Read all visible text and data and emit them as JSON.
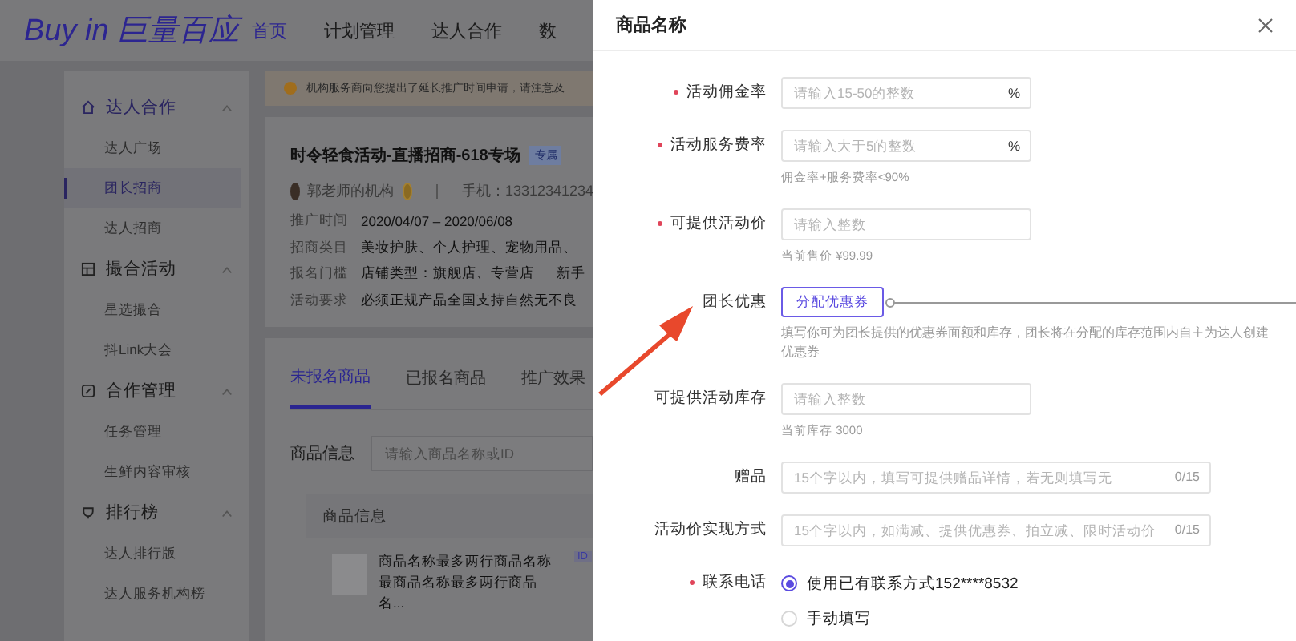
{
  "header": {
    "logo": "Buy in 巨量百应",
    "nav": [
      {
        "label": "首页",
        "selected": true
      },
      {
        "label": "计划管理",
        "selected": false
      },
      {
        "label": "达人合作",
        "selected": false
      },
      {
        "label": "数",
        "selected": false
      }
    ]
  },
  "sidebar": {
    "groups": [
      {
        "label": "达人合作",
        "expanded": true,
        "items": [
          {
            "label": "达人广场",
            "selected": false
          },
          {
            "label": "团长招商",
            "selected": true
          },
          {
            "label": "达人招商",
            "selected": false
          }
        ]
      },
      {
        "label": "撮合活动",
        "expanded": true,
        "items": [
          {
            "label": "星选撮合",
            "selected": false
          },
          {
            "label": "抖Link大会",
            "selected": false
          }
        ]
      },
      {
        "label": "合作管理",
        "expanded": true,
        "items": [
          {
            "label": "任务管理",
            "selected": false
          },
          {
            "label": "生鲜内容审核",
            "selected": false
          }
        ]
      },
      {
        "label": "排行榜",
        "expanded": true,
        "items": [
          {
            "label": "达人排行版",
            "selected": false
          },
          {
            "label": "达人服务机构榜",
            "selected": false
          }
        ]
      }
    ]
  },
  "notice": "机构服务商向您提出了延长推广时间申请，请注意及",
  "activity": {
    "title": "时令轻食活动-直播招商-618专场",
    "tag": "专属",
    "organizer": "郭老师的机构",
    "phone": "手机：13312341234",
    "details": [
      {
        "label": "推广时间",
        "value": "2020/04/07 – 2020/06/08"
      },
      {
        "label": "招商类目",
        "value": "美妆护肤、个人护理、宠物用品、"
      },
      {
        "label": "报名门槛",
        "value": "店铺类型：旗舰店、专营店",
        "extra": "新手"
      },
      {
        "label": "活动要求",
        "value": "必须正规产品全国支持自然无不良"
      }
    ]
  },
  "tabs": [
    {
      "label": "未报名商品",
      "selected": true
    },
    {
      "label": "已报名商品",
      "selected": false
    },
    {
      "label": "推广效果",
      "selected": false
    }
  ],
  "search": {
    "label": "商品信息",
    "placeholder": "请输入商品名称或ID"
  },
  "table": {
    "columns": [
      "商品信息"
    ],
    "rows": [
      {
        "name": "商品名称最多两行商品名称最商品名称最多两行商品名...",
        "badge": "ID"
      }
    ]
  },
  "drawer": {
    "title": "商品名称",
    "fields": [
      {
        "kind": "input",
        "label": "活动佣金率",
        "required": true,
        "placeholder": "请输入15-50的整数",
        "suffix": "%"
      },
      {
        "kind": "input",
        "label": "活动服务费率",
        "required": true,
        "placeholder": "请输入大于5的整数",
        "suffix": "%",
        "help": "佣金率+服务费率<90%"
      },
      {
        "kind": "input",
        "label": "可提供活动价",
        "required": true,
        "placeholder": "请输入整数",
        "help": "当前售价 ¥99.99"
      },
      {
        "kind": "button",
        "label": "团长优惠",
        "required": false,
        "button": "分配优惠券",
        "help": "填写你可为团长提供的优惠券面额和库存，团长将在分配的库存范围内自主为达人创建优惠券"
      },
      {
        "kind": "input",
        "label": "可提供活动库存",
        "required": false,
        "placeholder": "请输入整数",
        "help": "当前库存 3000"
      },
      {
        "kind": "wide",
        "label": "赠品",
        "required": false,
        "placeholder": "15个字以内，填写可提供赠品详情，若无则填写无",
        "counter": "0/15"
      },
      {
        "kind": "wide",
        "label": "活动价实现方式",
        "required": false,
        "placeholder": "15个字以内，如满减、提供优惠券、拍立减、限时活动价",
        "counter": "0/15"
      },
      {
        "kind": "radio",
        "label": "联系电话",
        "required": true,
        "options": [
          {
            "label": "使用已有联系方式152****8532",
            "selected": true
          },
          {
            "label": "手动填写",
            "selected": false
          }
        ]
      }
    ]
  }
}
